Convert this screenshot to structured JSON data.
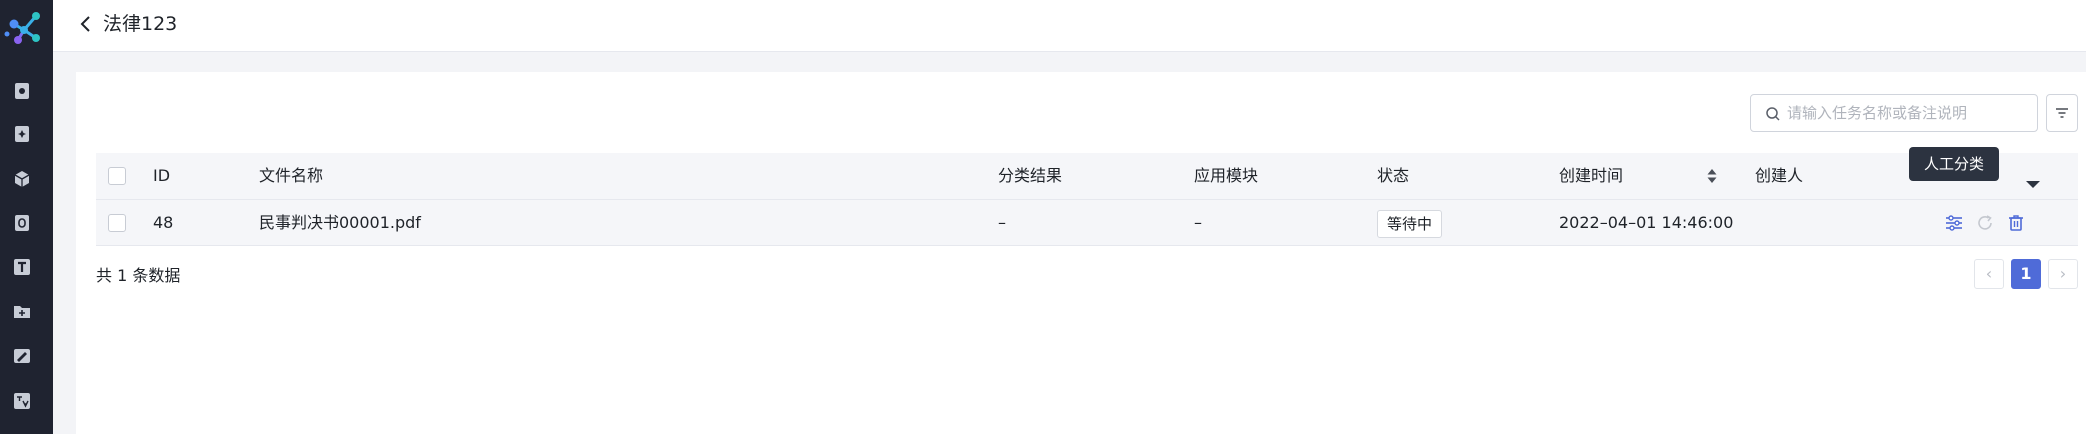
{
  "header": {
    "title": "法律123"
  },
  "toolbar": {
    "search_placeholder": "请输入任务名称或备注说明"
  },
  "table": {
    "columns": {
      "id": "ID",
      "filename": "文件名称",
      "result": "分类结果",
      "module": "应用模块",
      "status": "状态",
      "created_time": "创建时间",
      "creator": "创建人"
    },
    "rows": [
      {
        "id": "48",
        "filename": "民事判决书00001.pdf",
        "result": "–",
        "module": "–",
        "status": "等待中",
        "created_time": "2022–04–01 14:46:00",
        "creator": ""
      }
    ]
  },
  "tooltip": {
    "text": "人工分类"
  },
  "footer": {
    "total": "共 1 条数据",
    "current_page": "1",
    "prev": "‹",
    "next": "›"
  },
  "colors": {
    "sidebar": "#1f2330",
    "accent": "#4f6bd8",
    "tooltip": "#2c3340"
  },
  "icons": {
    "sidebar": [
      "brand-logo-icon",
      "doc-icon",
      "gear-doc-icon",
      "box-icon",
      "file-icon",
      "text-icon",
      "folder-icon",
      "edit-icon",
      "translate-icon"
    ],
    "actions": [
      "manual-classify-icon",
      "refresh-icon",
      "delete-icon"
    ]
  }
}
